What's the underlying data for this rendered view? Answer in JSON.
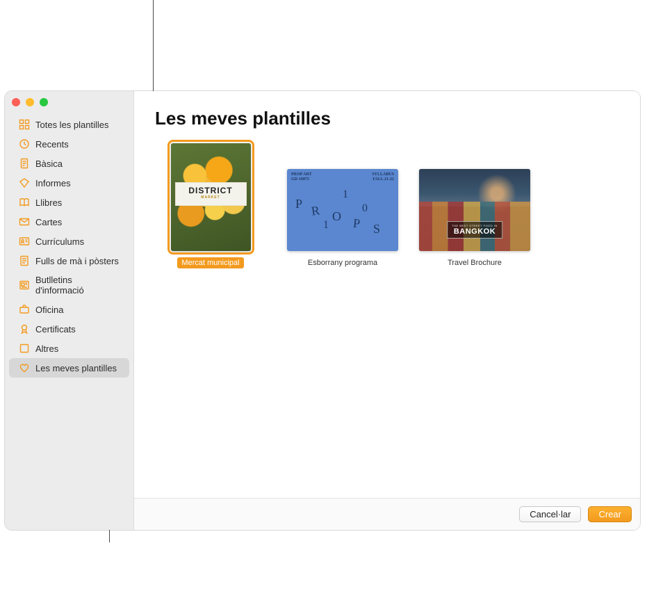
{
  "sidebar": {
    "items": [
      {
        "icon": "grid",
        "label": "Totes les plantilles"
      },
      {
        "icon": "clock",
        "label": "Recents"
      },
      {
        "icon": "page",
        "label": "Bàsica"
      },
      {
        "icon": "diamond",
        "label": "Informes"
      },
      {
        "icon": "book",
        "label": "Llibres"
      },
      {
        "icon": "envelope",
        "label": "Cartes"
      },
      {
        "icon": "id",
        "label": "Currículums"
      },
      {
        "icon": "sheet",
        "label": "Fulls de mà i pòsters"
      },
      {
        "icon": "news",
        "label": "Butlletins d'informació"
      },
      {
        "icon": "briefcase",
        "label": "Oficina"
      },
      {
        "icon": "ribbon",
        "label": "Certificats"
      },
      {
        "icon": "square",
        "label": "Altres"
      },
      {
        "icon": "heart",
        "label": "Les meves plantilles"
      }
    ],
    "selected_index": 12
  },
  "main": {
    "title": "Les meves plantilles",
    "templates": [
      {
        "name": "Mercat municipal",
        "selected": true,
        "orientation": "portrait",
        "thumb_texts": {
          "title": "DISTRICT",
          "subtitle": "MARKET"
        }
      },
      {
        "name": "Esborrany programa",
        "selected": false,
        "orientation": "landscape",
        "thumb_texts": {
          "top_left_1": "PROP ART",
          "top_left_2": "GD-10875",
          "top_right_1": "SYLLABUS",
          "top_right_2": "FALL 21-22",
          "letters": "PROPS",
          "numbers": "110"
        }
      },
      {
        "name": "Travel Brochure",
        "selected": false,
        "orientation": "landscape",
        "thumb_texts": {
          "tagline": "THE BEST STREET FOOD IN",
          "city": "BANGKOK"
        }
      }
    ]
  },
  "footer": {
    "cancel": "Cancel·lar",
    "create": "Crear"
  },
  "colors": {
    "accent": "#f39a1e",
    "sidebar_bg": "#ececec",
    "selected_row": "#d7d7d7"
  }
}
